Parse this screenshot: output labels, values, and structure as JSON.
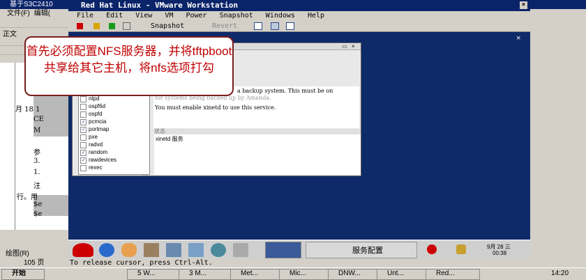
{
  "word": {
    "title": "基于S3C2410",
    "menu": [
      "文件(F)",
      "编辑("
    ],
    "doc_lines": [
      "月 18 1",
      "CE",
      "M",
      "参",
      "3.",
      "1.",
      "注",
      "行。用",
      "$e",
      "$e"
    ],
    "sections": [
      "正文"
    ],
    "bottom_status": "105 页",
    "bottom_menu": "绘图(R)"
  },
  "vmware": {
    "title": "Red Hat Linux - VMware Workstation",
    "menu": [
      "File",
      "Edit",
      "View",
      "VM",
      "Power",
      "Snapshot",
      "Windows",
      "Help"
    ],
    "toolbar": {
      "snapshot": "Snapshot",
      "revert": "Revert"
    },
    "status_text": "To release cursor, press Ctrl-Alt."
  },
  "dialog": {
    "services": [
      {
        "name": "ntpd",
        "checked": false
      },
      {
        "name": "ospf6d",
        "checked": false
      },
      {
        "name": "ospfd",
        "checked": false
      },
      {
        "name": "pcmcia",
        "checked": true
      },
      {
        "name": "portmap",
        "checked": true
      },
      {
        "name": "pxe",
        "checked": false
      },
      {
        "name": "radvd",
        "checked": false
      },
      {
        "name": "random",
        "checked": true
      },
      {
        "name": "rawdevices",
        "checked": true
      },
      {
        "name": "rexec",
        "checked": false
      }
    ],
    "description_lines": [
      "a backup system. This must be on",
      "for systems being backed up by Amanda.",
      "You must enable xinetd to use this service."
    ],
    "status_label": "状态",
    "status_value": "xinetd 服务"
  },
  "panel": {
    "task_label": "服务配置",
    "clock_date": "9月 28 三",
    "clock_time": "00:38"
  },
  "annotation": {
    "text": "首先必须配置NFS服务器，并将tftpboot共享给其它主机，将nfs选项打勾"
  },
  "taskbar": {
    "start": "开始",
    "buttons": [
      "5 W...",
      "3 M...",
      "Met...",
      "Mic...",
      "DNW...",
      "Unt...",
      "Red..."
    ],
    "clock": "14:20"
  }
}
